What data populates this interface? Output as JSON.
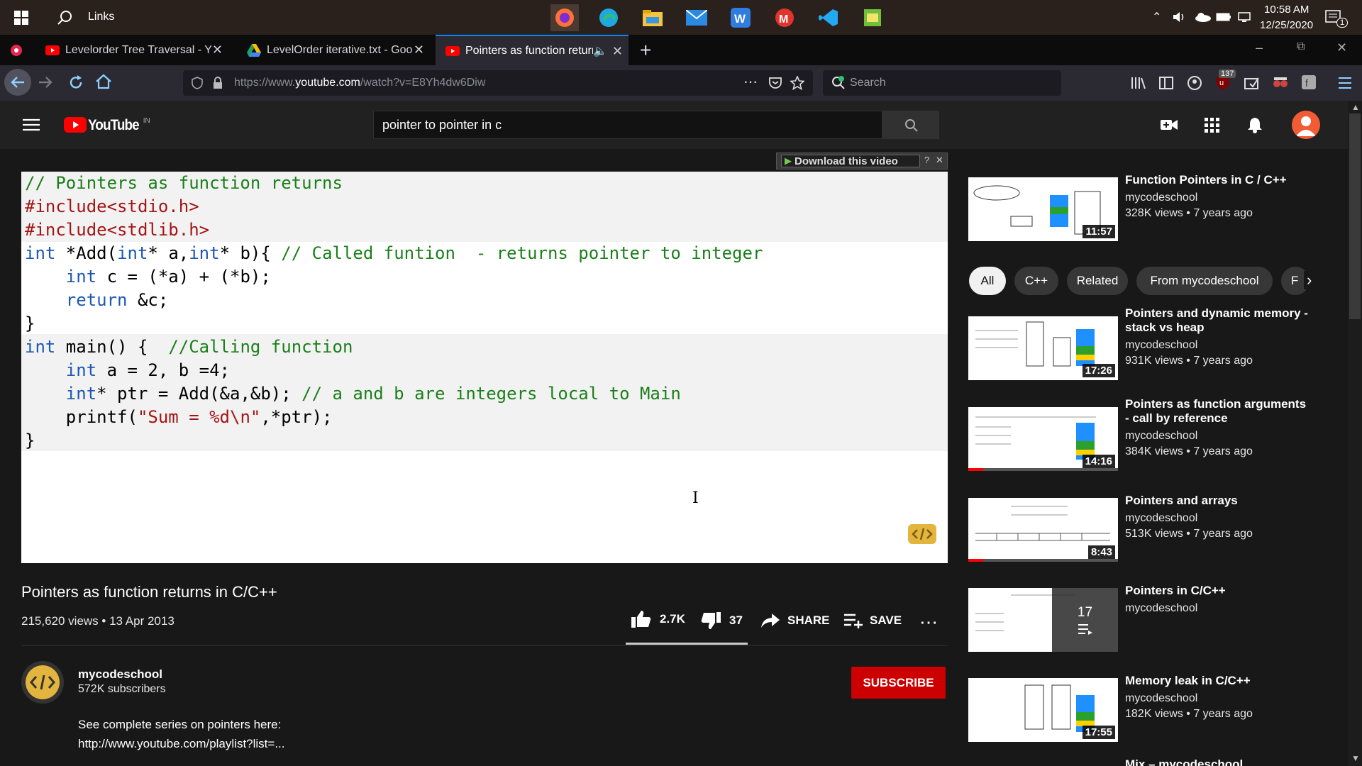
{
  "taskbar": {
    "search_label": "Links",
    "time": "10:58 AM",
    "date": "12/25/2020",
    "notification_count": "1"
  },
  "browser": {
    "tabs": [
      {
        "label": "Levelorder Tree Traversal - You",
        "icon": "youtube-icon"
      },
      {
        "label": "LevelOrder iterative.txt - Googl",
        "icon": "google-drive-icon"
      },
      {
        "label": "Pointers as function returns",
        "icon": "youtube-icon"
      }
    ],
    "url_prefix": "https://www.",
    "url_host": "youtube.com",
    "url_path": "/watch?v=E8Yh4dw6Diw",
    "search_placeholder": "Search",
    "badge_count": "137"
  },
  "youtube": {
    "logo_text": "YouTube",
    "logo_region": "IN",
    "search_value": "pointer to pointer in c",
    "download_label": "Download this video",
    "video": {
      "code": [
        {
          "parts": [
            [
              "cm",
              "// Pointers as function returns"
            ]
          ]
        },
        {
          "parts": [
            [
              "pp",
              "#include<stdio.h>"
            ]
          ]
        },
        {
          "parts": [
            [
              "pp",
              "#include<stdlib.h>"
            ]
          ]
        },
        {
          "parts": [
            [
              "kw",
              "int"
            ],
            [
              "",
              " *Add("
            ],
            [
              "kw",
              "int"
            ],
            [
              "",
              "* a,"
            ],
            [
              "kw",
              "int"
            ],
            [
              "",
              "* b){ "
            ],
            [
              "cm",
              "// Called funtion  - returns pointer to integer"
            ]
          ]
        },
        {
          "parts": [
            [
              "",
              "    "
            ],
            [
              "kw",
              "int"
            ],
            [
              "",
              " c = (*a) + (*b);"
            ]
          ]
        },
        {
          "parts": [
            [
              "",
              "    "
            ],
            [
              "kw",
              "return"
            ],
            [
              "",
              " &c;"
            ]
          ]
        },
        {
          "parts": [
            [
              "",
              "}"
            ]
          ]
        },
        {
          "parts": [
            [
              "kw",
              "int"
            ],
            [
              "",
              " main() {  "
            ],
            [
              "cm",
              "//Calling function"
            ]
          ]
        },
        {
          "parts": [
            [
              "",
              "    "
            ],
            [
              "kw",
              "int"
            ],
            [
              "",
              " a = 2, b =4;"
            ]
          ]
        },
        {
          "parts": [
            [
              "",
              "    "
            ],
            [
              "kw",
              "int"
            ],
            [
              "",
              "* ptr = Add(&a,&b); "
            ],
            [
              "cm",
              "// a and b are integers local to Main"
            ]
          ]
        },
        {
          "parts": [
            [
              "",
              "    printf("
            ],
            [
              "st",
              "\"Sum = %d\\n\""
            ],
            [
              "",
              ",*ptr);"
            ]
          ]
        },
        {
          "parts": [
            [
              "",
              "}"
            ]
          ]
        }
      ],
      "title": "Pointers as function returns in C/C++",
      "views_date": "215,620 views • 13 Apr 2013",
      "likes": "2.7K",
      "dislikes": "37",
      "share_label": "SHARE",
      "save_label": "SAVE"
    },
    "channel": {
      "name": "mycodeschool",
      "subscribers": "572K subscribers",
      "subscribe_label": "SUBSCRIBE",
      "description_line1": "See complete series on pointers here:",
      "description_line2": "http://www.youtube.com/playlist?list=..."
    },
    "chips": [
      "All",
      "C++",
      "Related",
      "From mycodeschool",
      "F"
    ],
    "recommendations": [
      {
        "title": "Function Pointers in C / C++",
        "channel": "mycodeschool",
        "meta": "328K views • 7 years ago",
        "duration": "11:57"
      },
      {
        "title": "Pointers and dynamic memory - stack vs heap",
        "channel": "mycodeschool",
        "meta": "931K views • 7 years ago",
        "duration": "17:26"
      },
      {
        "title": "Pointers as function arguments - call by reference",
        "channel": "mycodeschool",
        "meta": "384K views • 7 years ago",
        "duration": "14:16",
        "watched": 0.1
      },
      {
        "title": "Pointers and arrays",
        "channel": "mycodeschool",
        "meta": "513K views • 7 years ago",
        "duration": "8:43",
        "watched": 0.1
      },
      {
        "title": "Pointers in C/C++",
        "channel": "mycodeschool",
        "playlist_count": "17"
      },
      {
        "title": "Memory leak in C/C++",
        "channel": "mycodeschool",
        "meta": "182K views • 7 years ago",
        "duration": "17:55"
      },
      {
        "title": "Mix – mycodeschool"
      }
    ]
  },
  "colors": {
    "youtube_red": "#ff0000",
    "subscribe_red": "#cc0000",
    "accent_blue": "#3ea6ff"
  }
}
